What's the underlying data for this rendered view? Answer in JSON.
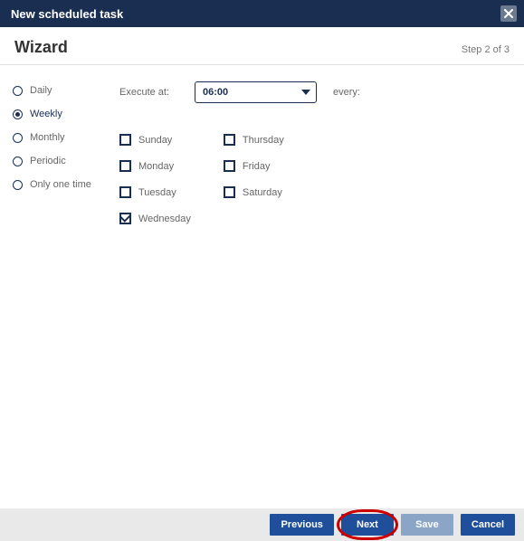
{
  "titlebar": {
    "title": "New scheduled task"
  },
  "step_header": {
    "wizard_label": "Wizard",
    "step_text": "Step 2 of 3"
  },
  "sidebar": {
    "options": [
      {
        "id": "daily",
        "label": "Daily",
        "selected": false
      },
      {
        "id": "weekly",
        "label": "Weekly",
        "selected": true
      },
      {
        "id": "monthly",
        "label": "Monthly",
        "selected": false
      },
      {
        "id": "periodic",
        "label": "Periodic",
        "selected": false
      },
      {
        "id": "once",
        "label": "Only one time",
        "selected": false
      }
    ]
  },
  "execute": {
    "label": "Execute at:",
    "time_value": "06:00",
    "every_label": "every:"
  },
  "days": {
    "col1": [
      {
        "id": "sunday",
        "label": "Sunday",
        "checked": false
      },
      {
        "id": "monday",
        "label": "Monday",
        "checked": false
      },
      {
        "id": "tuesday",
        "label": "Tuesday",
        "checked": false
      },
      {
        "id": "wednesday",
        "label": "Wednesday",
        "checked": true
      }
    ],
    "col2": [
      {
        "id": "thursday",
        "label": "Thursday",
        "checked": false
      },
      {
        "id": "friday",
        "label": "Friday",
        "checked": false
      },
      {
        "id": "saturday",
        "label": "Saturday",
        "checked": false
      }
    ]
  },
  "footer": {
    "previous": "Previous",
    "next": "Next",
    "save": "Save",
    "cancel": "Cancel",
    "save_enabled": false,
    "next_highlighted": true
  }
}
